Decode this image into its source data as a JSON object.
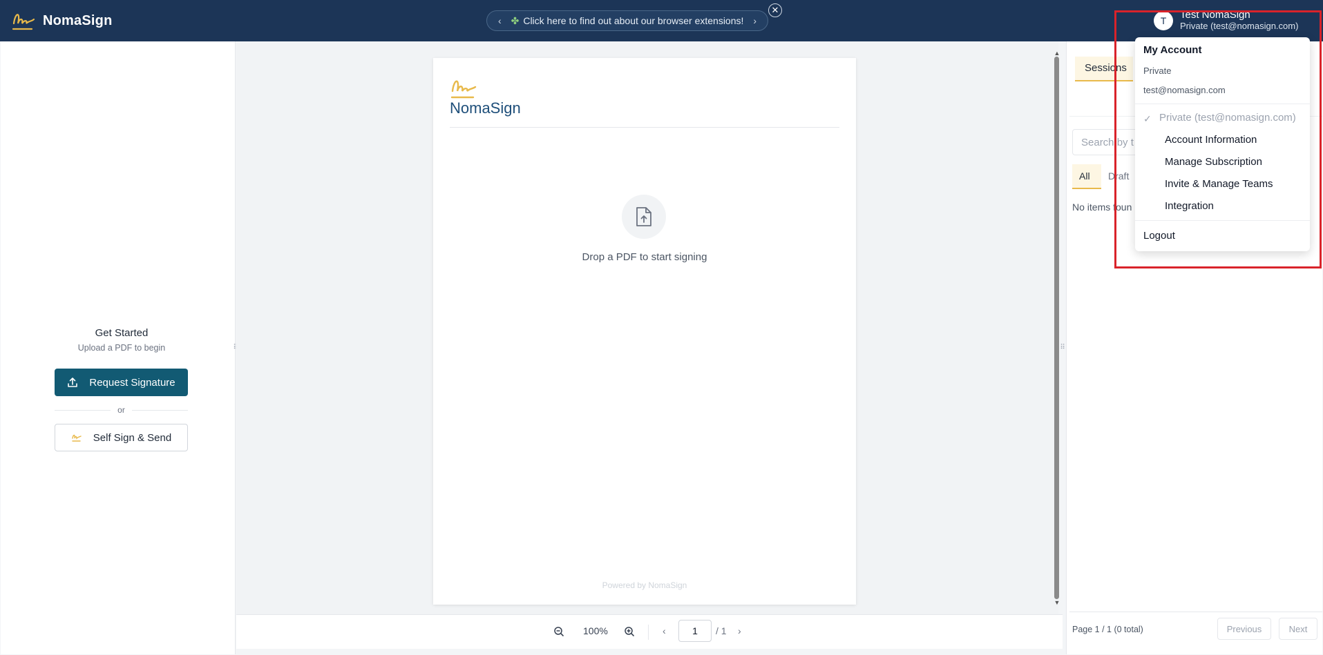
{
  "app": {
    "brand": "NomaSign"
  },
  "banner": {
    "text": "Click here to find out about our browser extensions!",
    "close": "✕"
  },
  "user": {
    "initial": "T",
    "name": "Test NomaSign",
    "subtitle": "Private (test@nomasign.com)"
  },
  "left": {
    "title": "Get Started",
    "subtitle": "Upload a PDF to begin",
    "request_label": "Request Signature",
    "or": "or",
    "selfsign_label": "Self Sign & Send"
  },
  "viewer": {
    "page_brand": "NomaSign",
    "drop_text": "Drop a PDF to start signing",
    "powered": "Powered by NomaSign",
    "zoom": "100%",
    "page_value": "1",
    "page_total": "/ 1"
  },
  "right": {
    "tab_sessions": "Sessions",
    "search_placeholder": "Search by t",
    "filter_all": "All",
    "filter_draft": "Draft",
    "no_items": "No items foun",
    "pager_text": "Page 1 / 1 (0 total)",
    "prev": "Previous",
    "next": "Next"
  },
  "dropdown": {
    "title": "My Account",
    "account_type": "Private",
    "email": "test@nomasign.com",
    "current": "Private (test@nomasign.com)",
    "items": [
      "Account Information",
      "Manage Subscription",
      "Invite & Manage Teams",
      "Integration"
    ],
    "logout": "Logout"
  },
  "colors": {
    "header": "#1c3557",
    "primary_button": "#125a73",
    "accent": "#e8b94a",
    "highlight": "#d9232a"
  }
}
